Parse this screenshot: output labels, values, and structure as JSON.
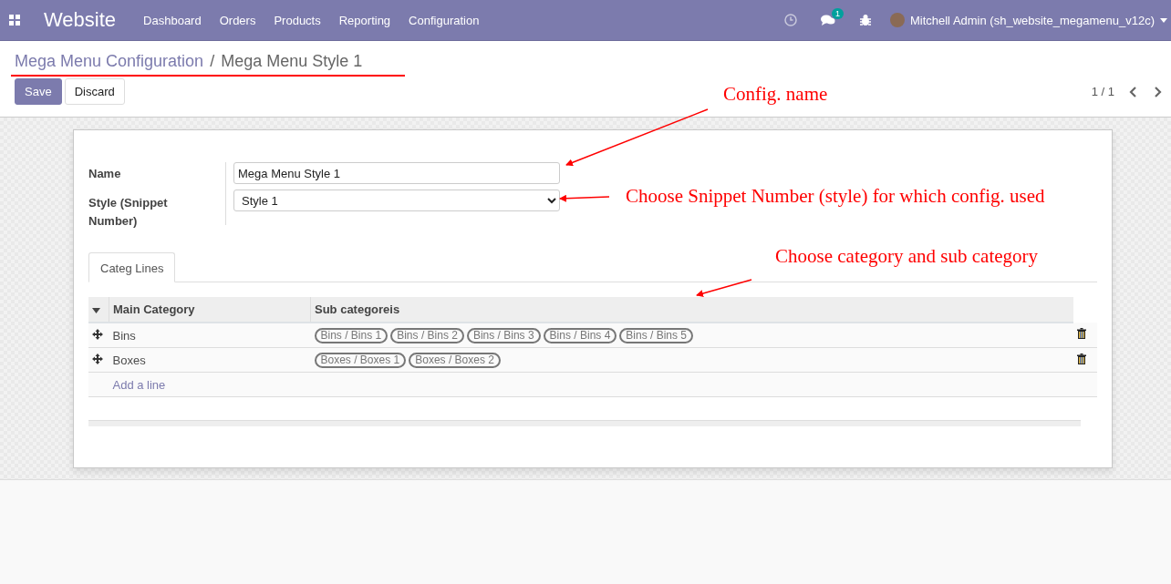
{
  "navbar": {
    "app_name": "Website",
    "menu": [
      "Dashboard",
      "Orders",
      "Products",
      "Reporting",
      "Configuration"
    ],
    "messages_badge": "1",
    "user": "Mitchell Admin (sh_website_megamenu_v12c)"
  },
  "breadcrumb": [
    {
      "label": "Mega Menu Configuration",
      "link": true
    },
    {
      "label": "Mega Menu Style 1",
      "link": false
    }
  ],
  "breadcrumb_separator": "/",
  "buttons": [
    {
      "label": "Save",
      "kind": "primary"
    },
    {
      "label": "Discard",
      "kind": "secondary"
    }
  ],
  "pager": "1 / 1",
  "form": {
    "fields": [
      {
        "label": "Name",
        "kind": "input",
        "value": "Mega Menu Style 1"
      },
      {
        "label": "Style (Snippet Number)",
        "kind": "select",
        "value": "Style 1"
      }
    ],
    "tabs": [
      {
        "label": "Categ Lines",
        "selected": true
      }
    ],
    "table": {
      "columns": [
        "Main Category",
        "Sub categoreis"
      ],
      "rows": [
        {
          "main": "Bins",
          "tags": [
            "Bins / Bins 1",
            "Bins / Bins 2",
            "Bins / Bins 3",
            "Bins / Bins 4",
            "Bins / Bins 5"
          ]
        },
        {
          "main": "Boxes",
          "tags": [
            "Boxes / Boxes 1",
            "Boxes / Boxes 2"
          ]
        }
      ],
      "add_line": "Add a line"
    }
  },
  "annotations": [
    {
      "kind": "name",
      "text": "Config. name"
    },
    {
      "kind": "style",
      "text": "Choose Snippet Number (style) for which config. used"
    },
    {
      "kind": "category",
      "text": "Choose category and sub category"
    }
  ]
}
